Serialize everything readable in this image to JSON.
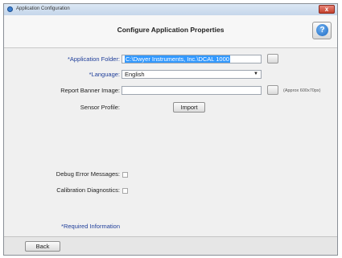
{
  "window": {
    "title": "Application Configuration",
    "close_label": "x"
  },
  "header": {
    "title": "Configure Application Properties",
    "help_label": "?"
  },
  "form": {
    "app_folder": {
      "label": "*Application Folder:",
      "value": "C:\\Dwyer Instruments, Inc.\\DCAL 1000"
    },
    "language": {
      "label": "*Language:",
      "value": "English"
    },
    "report_banner": {
      "label": "Report Banner Image:",
      "value": "",
      "hint": "(Approx 600x70px)"
    },
    "sensor_profile": {
      "label": "Sensor Profile:",
      "button_label": "Import"
    },
    "debug_errors": {
      "label": "Debug Error Messages:",
      "checked": false
    },
    "calibration_diag": {
      "label": "Calibration Diagnostics:",
      "checked": false
    },
    "required_note": "*Required Information"
  },
  "footer": {
    "back_label": "Back"
  },
  "colors": {
    "required_text": "#1f3e9a",
    "selection": "#3399ff"
  }
}
